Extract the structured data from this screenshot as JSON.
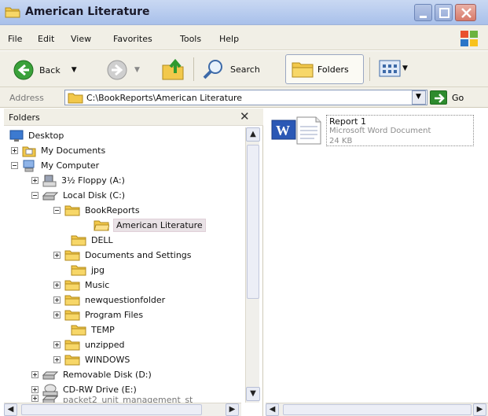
{
  "window": {
    "title": "American Literature"
  },
  "menu": [
    "File",
    "Edit",
    "View",
    "Favorites",
    "Tools",
    "Help"
  ],
  "toolbar": {
    "back_label": "Back",
    "search_label": "Search",
    "folders_label": "Folders"
  },
  "address": {
    "label": "Address",
    "path": "C:\\BookReports\\American Literature",
    "go_label": "Go"
  },
  "folders_pane": {
    "title": "Folders",
    "close_glyph": "✕",
    "tree": [
      {
        "label": "Desktop"
      },
      {
        "label": "My Documents"
      },
      {
        "label": "My Computer"
      },
      {
        "label": "3½ Floppy (A:)"
      },
      {
        "label": "Local Disk (C:)"
      },
      {
        "label": "BookReports"
      },
      {
        "label": "American Literature"
      },
      {
        "label": "DELL"
      },
      {
        "label": "Documents and Settings"
      },
      {
        "label": "jpg"
      },
      {
        "label": "Music"
      },
      {
        "label": "newquestionfolder"
      },
      {
        "label": "Program Files"
      },
      {
        "label": "TEMP"
      },
      {
        "label": "unzipped"
      },
      {
        "label": "WINDOWS"
      },
      {
        "label": "Removable Disk (D:)"
      },
      {
        "label": "CD-RW Drive (E:)"
      },
      {
        "label": "packet2_unit_management_st"
      }
    ]
  },
  "file_pane": {
    "items": [
      {
        "name": "Report 1",
        "type": "Microsoft Word Document",
        "size": "24 KB",
        "icon": "word-doc-icon"
      }
    ]
  },
  "colors": {
    "title_bar": "#b7cbee",
    "toolbar_bg": "#f1efe6",
    "folder": "#f2c84b",
    "go_green": "#2e8b2e",
    "close_red": "#d77a6a"
  }
}
